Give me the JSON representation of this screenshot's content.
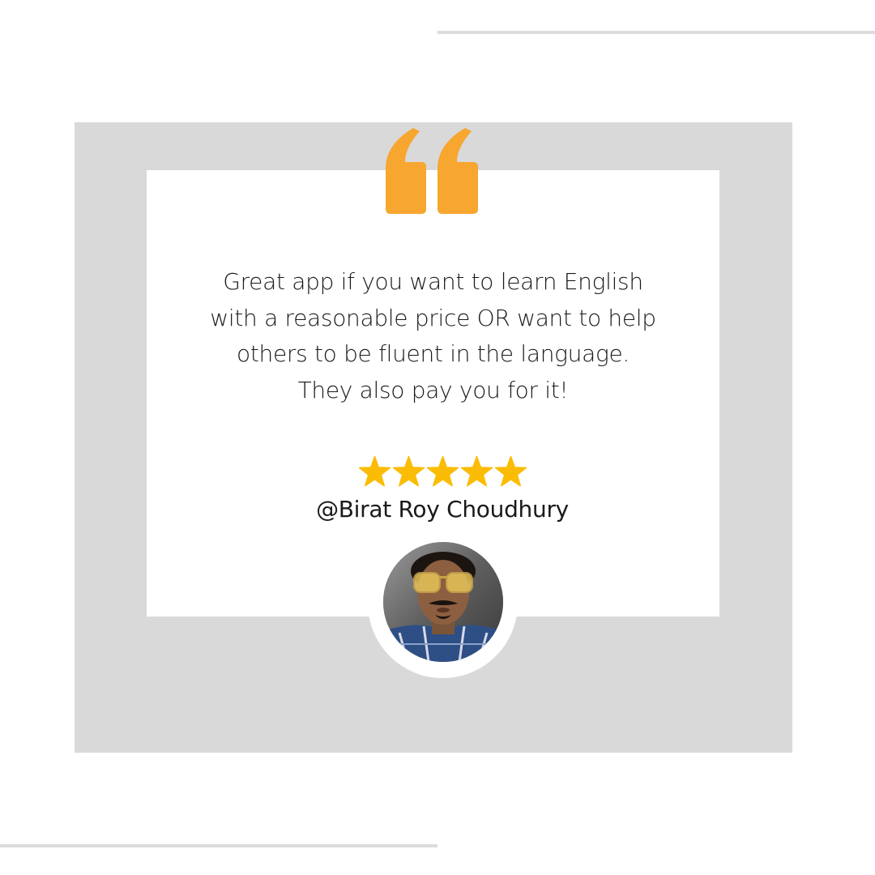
{
  "testimonial": {
    "quote_icon": "double-quote-icon",
    "text": "Great app if you want to learn English\nwith a reasonable price OR want to help\nothers to be fluent in the language.\nThey also pay you for it!",
    "rating": 5,
    "rating_max": 5,
    "star_icon": "star-icon",
    "reviewer": "@Birat Roy Choudhury"
  },
  "colors": {
    "accent": "#f7a630",
    "star": "#fbbc05",
    "frame": "#d9d9d9",
    "card": "#ffffff",
    "text": "#1a1a1a"
  }
}
